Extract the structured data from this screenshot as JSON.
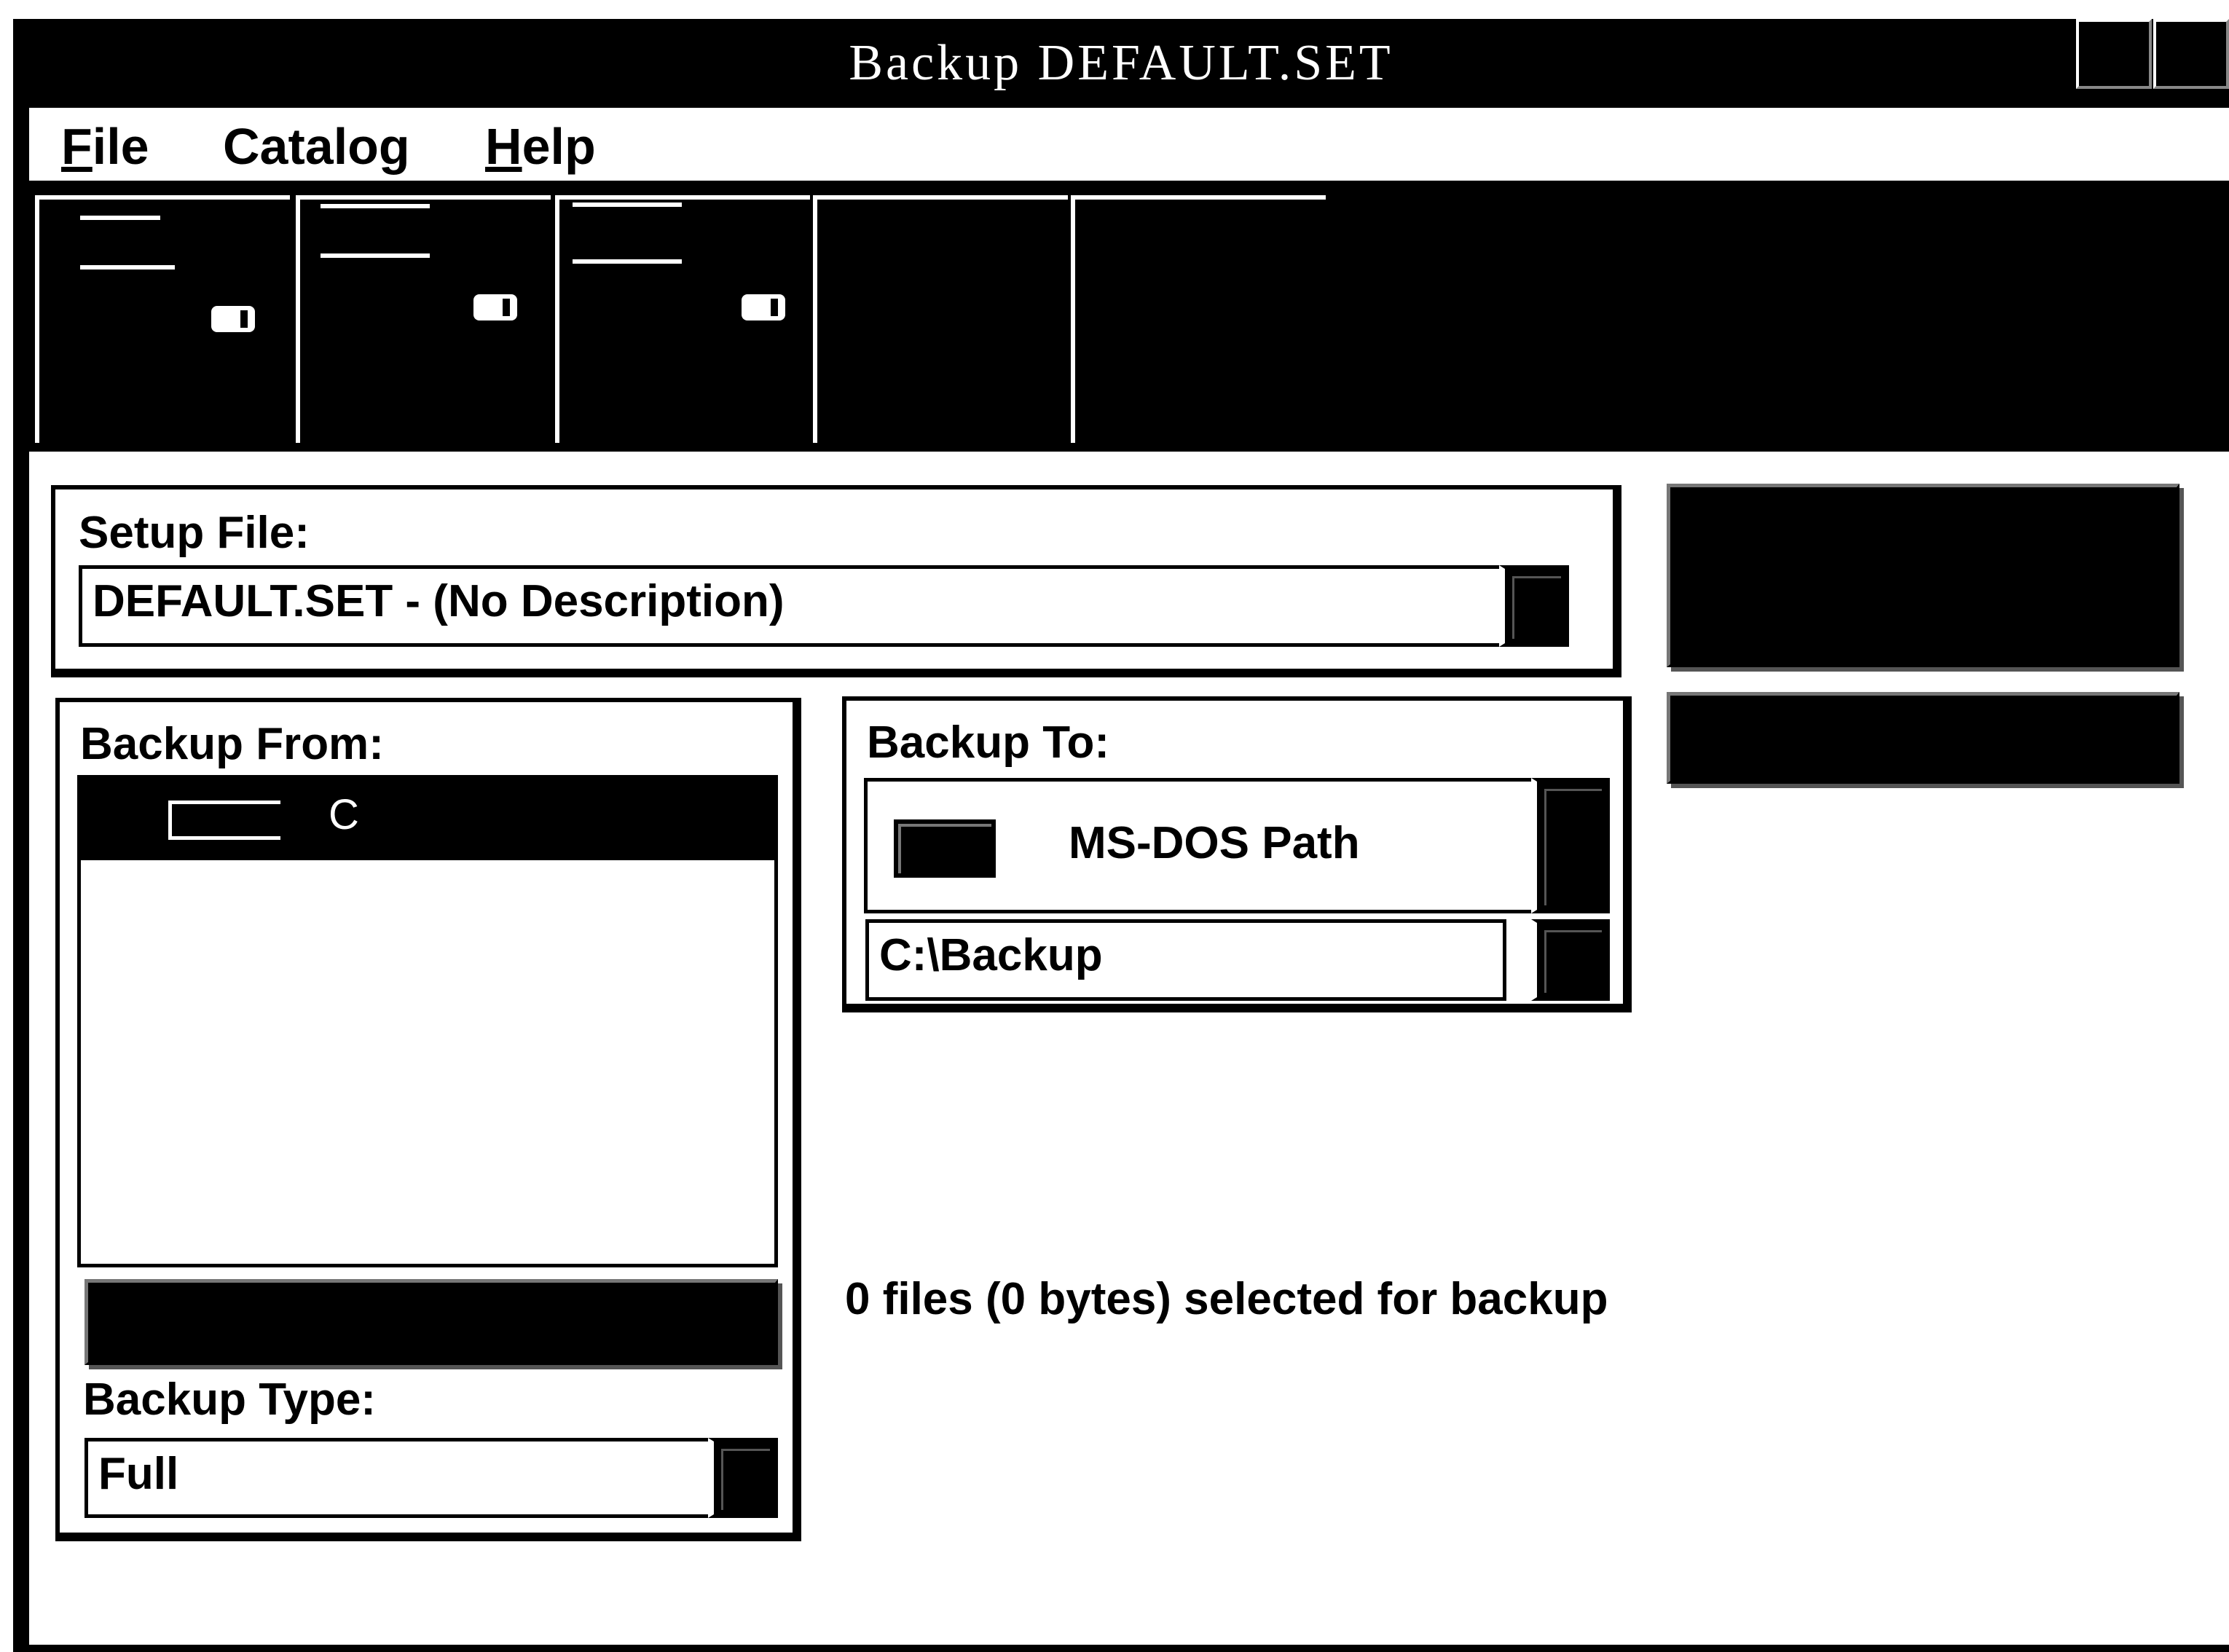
{
  "window": {
    "title": "Backup   DEFAULT.SET"
  },
  "menu": {
    "items": [
      {
        "label": "File",
        "mnemonic": "F",
        "rest": "ile"
      },
      {
        "label": "Catalog",
        "mnemonic": "",
        "rest": "Catalog"
      },
      {
        "label": "Help",
        "mnemonic": "H",
        "rest": "elp"
      }
    ]
  },
  "toolbar": {
    "button_icons": [
      "backup-disk-icon",
      "compare-disk-icon",
      "restore-disk-icon",
      "configure-icon",
      "options-icon"
    ]
  },
  "setup_file": {
    "label": "Setup File:",
    "value": "DEFAULT.SET - (No Description)"
  },
  "backup_from": {
    "label": "Backup From:",
    "drives": [
      {
        "letter": "C",
        "selected": true
      }
    ]
  },
  "backup_to": {
    "label": "Backup To:",
    "destination": "MS-DOS Path",
    "path": "C:\\Backup"
  },
  "backup_type": {
    "label": "Backup Type:",
    "value": "Full"
  },
  "status": {
    "text": "0 files (0 bytes) selected for backup"
  },
  "colors": {
    "titlebar": "#000000",
    "window_bg": "#ffffff",
    "selection": "#000000"
  }
}
